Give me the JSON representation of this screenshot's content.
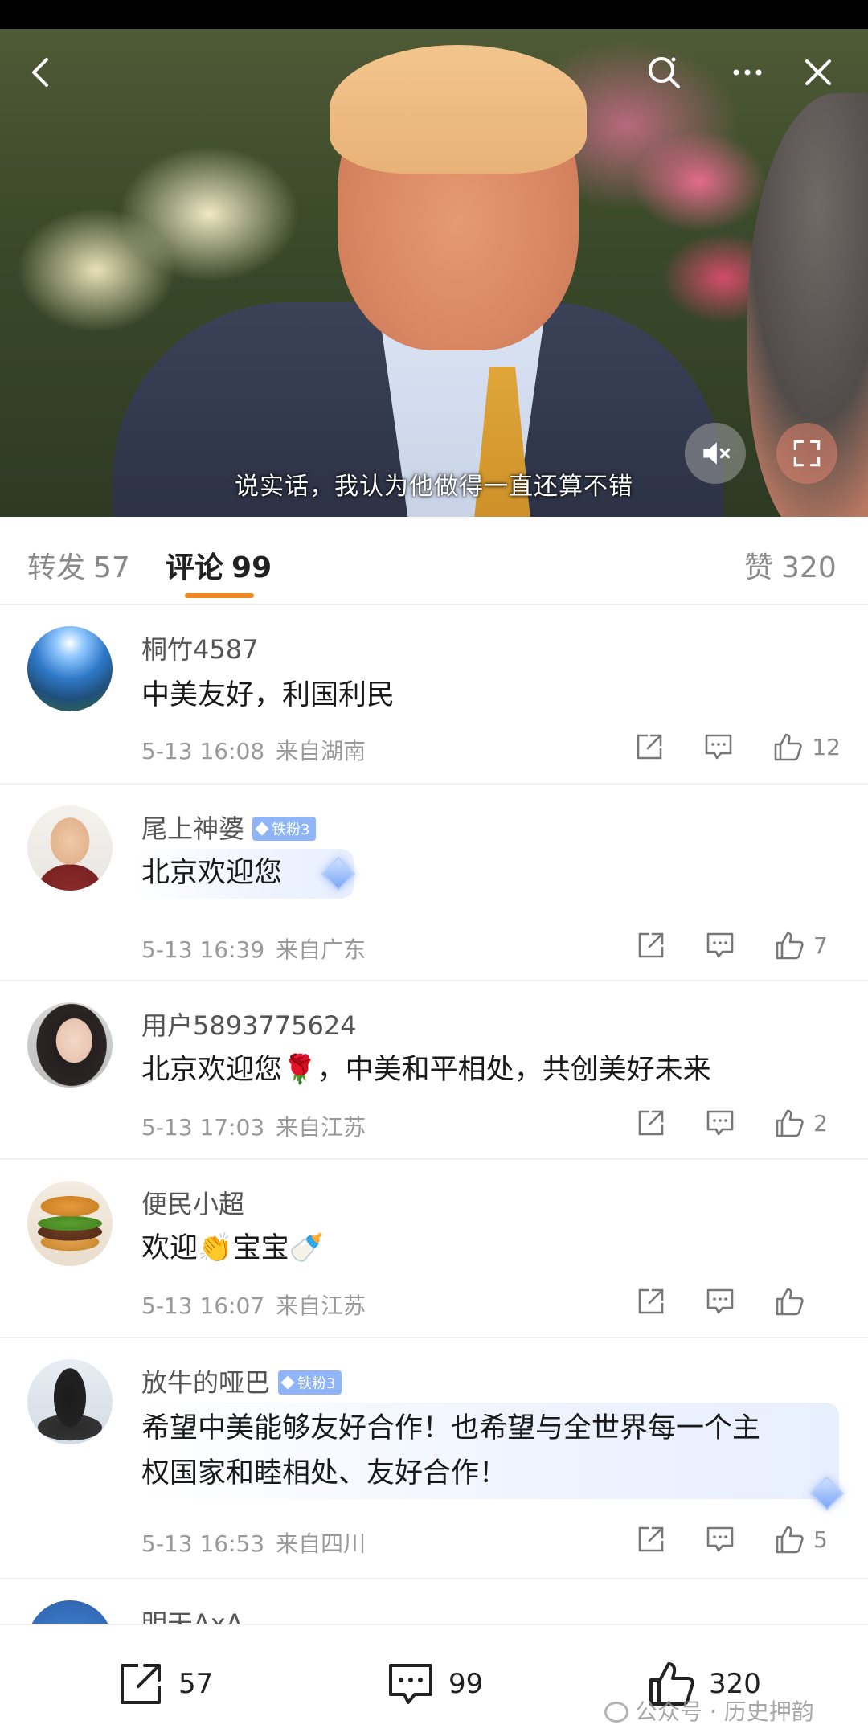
{
  "video": {
    "subtitle": "说实话，我认为他做得一直还算不错",
    "icons": [
      "back-icon",
      "search-icon",
      "more-icon",
      "close-icon",
      "mute-icon",
      "fullscreen-icon"
    ]
  },
  "tabs": {
    "repost_label": "转发",
    "repost_count": "57",
    "comment_label": "评论",
    "comment_count": "99",
    "like_label": "赞",
    "like_count": "320"
  },
  "comments": [
    {
      "user": "桐竹4587",
      "badge": "",
      "text": "中美友好，利国利民",
      "time": "5-13 16:08",
      "location": "来自湖南",
      "likes": "12"
    },
    {
      "user": "尾上神婆",
      "badge": "铁粉3",
      "text": "北京欢迎您",
      "time": "5-13 16:39",
      "location": "来自广东",
      "likes": "7"
    },
    {
      "user": "用户5893775624",
      "badge": "",
      "text": "北京欢迎您🌹，中美和平相处，共创美好未来",
      "time": "5-13 17:03",
      "location": "来自江苏",
      "likes": "2"
    },
    {
      "user": "便民小超",
      "badge": "",
      "text": "欢迎👏宝宝🍼",
      "time": "5-13 16:07",
      "location": "来自江苏",
      "likes": ""
    },
    {
      "user": "放牛的哑巴",
      "badge": "铁粉3",
      "text_line1": "希望中美能够友好合作！也希望与全世界每一个主",
      "text_line2": "权国家和睦相处、友好合作！",
      "time": "5-13 16:53",
      "location": "来自四川",
      "likes": "5"
    },
    {
      "user": "明天AxA"
    }
  ],
  "bottom": {
    "repost_count": "57",
    "comment_count": "99",
    "like_count": "320",
    "watermark": "公众号 · 历史押韵"
  },
  "colors": {
    "accent": "#f08a24",
    "badge": "#8fb5f7"
  }
}
